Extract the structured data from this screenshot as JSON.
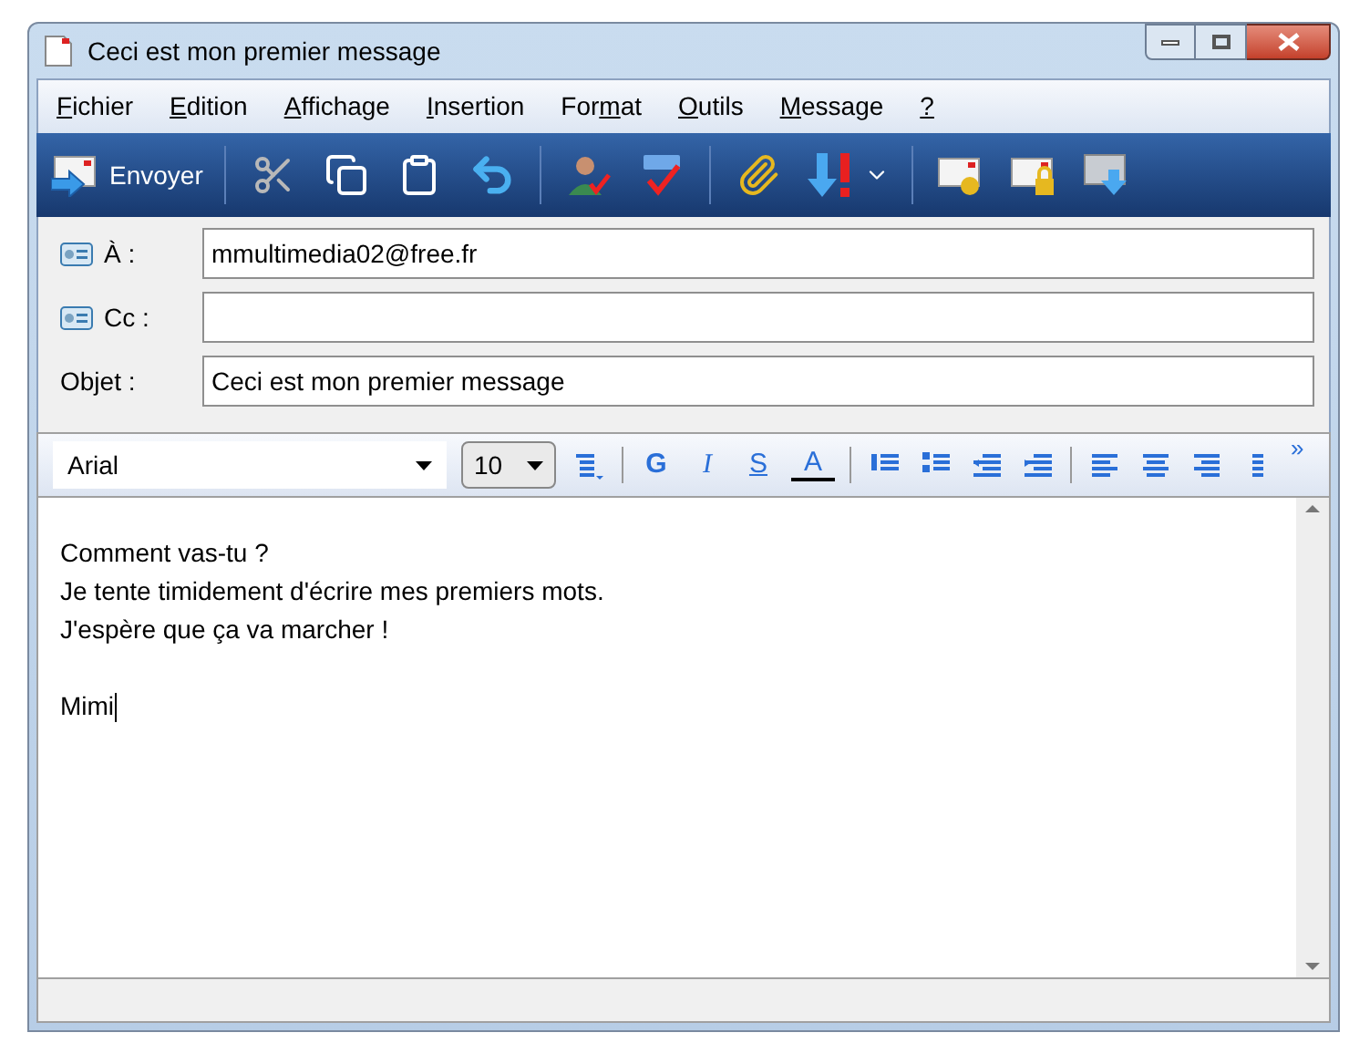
{
  "window": {
    "title": "Ceci est mon premier message"
  },
  "menu": [
    {
      "key": "F",
      "rest": "ichier"
    },
    {
      "key": "E",
      "rest": "dition"
    },
    {
      "key": "A",
      "rest": "ffichage"
    },
    {
      "key": "I",
      "rest": "nsertion"
    },
    {
      "prefix": "For",
      "key": "m",
      "rest": "at"
    },
    {
      "key": "O",
      "rest": "utils"
    },
    {
      "key": "M",
      "rest": "essage"
    },
    {
      "key": "?"
    }
  ],
  "toolbar": {
    "send_label": "Envoyer"
  },
  "fields": [
    {
      "kind": "address",
      "label": "À :",
      "value": "mmultimedia02@free.fr"
    },
    {
      "kind": "address",
      "label": "Cc :"
    },
    {
      "kind": "plain",
      "label": "Objet :",
      "value": "Ceci est mon premier message"
    }
  ],
  "format_bar": {
    "font": "Arial",
    "size": "10",
    "bold": "G",
    "italic": "I",
    "underline": "S",
    "font_color_label": "A",
    "more": "»"
  },
  "body": {
    "paragraphs": [
      [
        "Comment vas-tu ?",
        "Je tente timidement d'écrire mes premiers mots.",
        "J'espère que ça va marcher !"
      ],
      [
        "Mimi"
      ]
    ]
  }
}
